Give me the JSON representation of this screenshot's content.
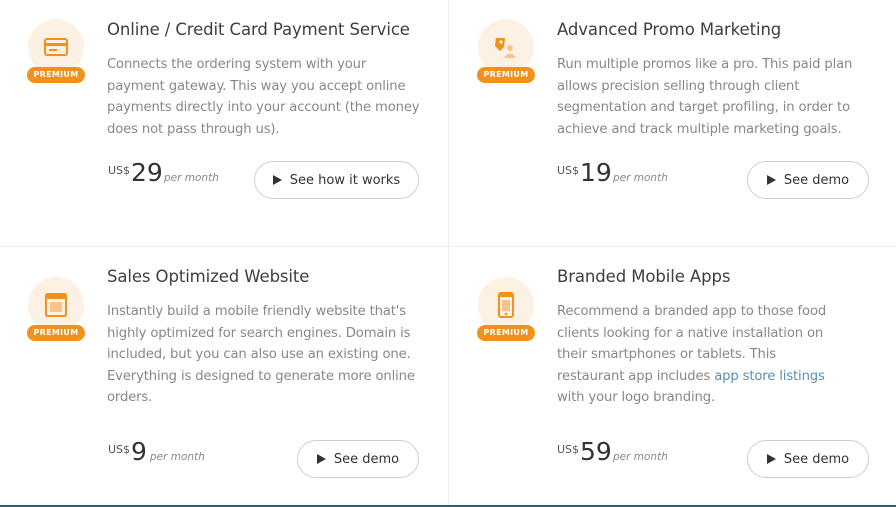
{
  "cards": [
    {
      "title": "Online / Credit Card Payment Service",
      "description": "Connects the ordering system with your payment gateway. This way you accept online payments directly into your account (the money does not pass through us).",
      "badge": "PREMIUM",
      "icon": "credit-card-icon",
      "currency": "US$",
      "amount": "29",
      "period": "per month",
      "button_label": "See how it works"
    },
    {
      "title": "Advanced Promo Marketing",
      "description": "Run multiple promos like a pro. This paid plan allows precision selling through client segmentation and target profiling, in order to achieve and track multiple marketing goals.",
      "badge": "PREMIUM",
      "icon": "promo-tag-icon",
      "currency": "US$",
      "amount": "19",
      "period": "per month",
      "button_label": "See demo"
    },
    {
      "title": "Sales Optimized Website",
      "description": "Instantly build a mobile friendly website that's highly optimized for search engines. Domain is included, but you can also use an existing one. Everything is designed to generate more online orders.",
      "badge": "PREMIUM",
      "icon": "website-icon",
      "currency": "US$",
      "amount": "9",
      "period": "per month",
      "button_label": "See demo"
    },
    {
      "title": "Branded Mobile Apps",
      "description_before": "Recommend a branded app to those food clients looking for a native installation on their smartphones or tablets. This restaurant app includes ",
      "description_link": "app store listings",
      "description_after": " with your logo branding.",
      "badge": "PREMIUM",
      "icon": "mobile-app-icon",
      "currency": "US$",
      "amount": "59",
      "period": "per month",
      "button_label": "See demo"
    }
  ],
  "colors": {
    "accent": "#f0921a",
    "icon_bg": "#fdf1e4",
    "link": "#5b8fb0",
    "bottom_bar": "#2f5f63"
  }
}
